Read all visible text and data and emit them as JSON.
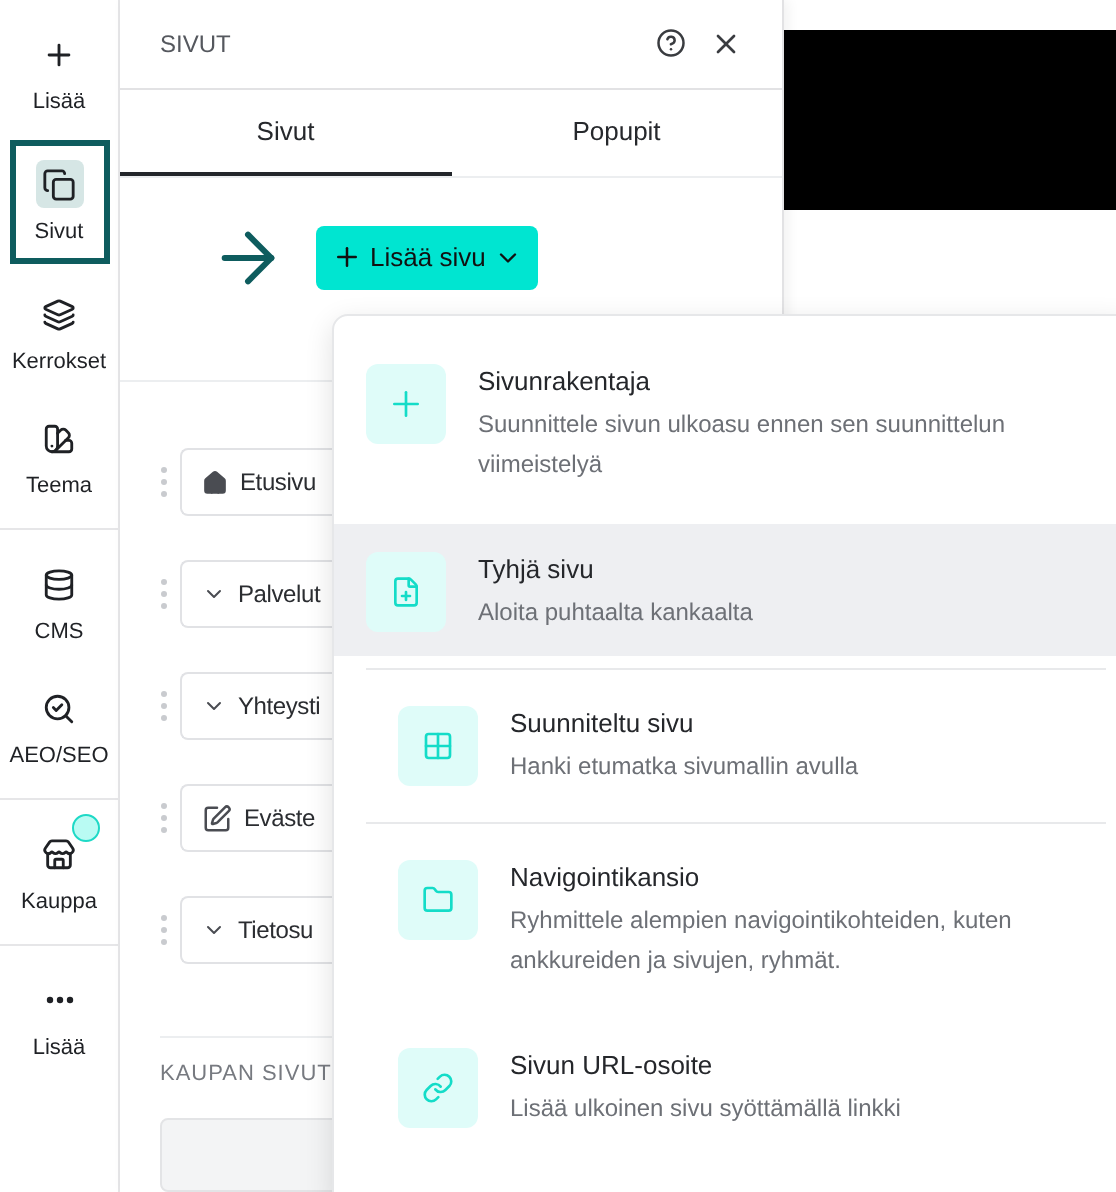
{
  "rail": {
    "groups": [
      [
        {
          "label": "Lisää",
          "selected": false
        },
        {
          "label": "Sivut",
          "selected": true
        },
        {
          "label": "Kerrokset",
          "selected": false
        },
        {
          "label": "Teema",
          "selected": false
        }
      ],
      [
        {
          "label": "CMS",
          "selected": false
        },
        {
          "label": "AEO/SEO",
          "selected": false
        }
      ],
      [
        {
          "label": "Kauppa",
          "selected": false
        }
      ],
      [
        {
          "label": "Lisää",
          "selected": false
        }
      ]
    ]
  },
  "panel": {
    "title": "SIVUT",
    "tabs": [
      {
        "label": "Sivut",
        "selected": true
      },
      {
        "label": "Popupit",
        "selected": false
      }
    ],
    "add_button": {
      "label": "Lisää sivu"
    },
    "pages": [
      {
        "name": "Etusivu",
        "kind": "home"
      },
      {
        "name": "Palvelut",
        "kind": "folder"
      },
      {
        "name": "Yhteysti",
        "kind": "folder"
      },
      {
        "name": "Eväste",
        "kind": "edit"
      },
      {
        "name": "Tietosu",
        "kind": "folder"
      }
    ],
    "section_title": "KAUPAN SIVUT"
  },
  "menu": {
    "groups": [
      [
        {
          "title": "Sivunrakentaja",
          "description": "Suunnittele sivun ulkoasu ennen sen suunnittelun viimeistelyä",
          "selected": false
        },
        {
          "title": "Tyhjä sivu",
          "description": "Aloita puhtaalta kankaalta",
          "selected": true
        }
      ],
      [
        {
          "title": "Suunniteltu sivu",
          "description": "Hanki etumatka sivumallin avulla",
          "selected": false
        }
      ],
      [
        {
          "title": "Navigointikansio",
          "description": "Ryhmittele alempien navigointikohteiden, kuten ankkureiden ja sivujen, ryhmät.",
          "selected": false
        },
        {
          "title": "Sivun URL-osoite",
          "description": "Lisää ulkoinen sivu syöttämällä linkki",
          "selected": false
        }
      ]
    ]
  }
}
